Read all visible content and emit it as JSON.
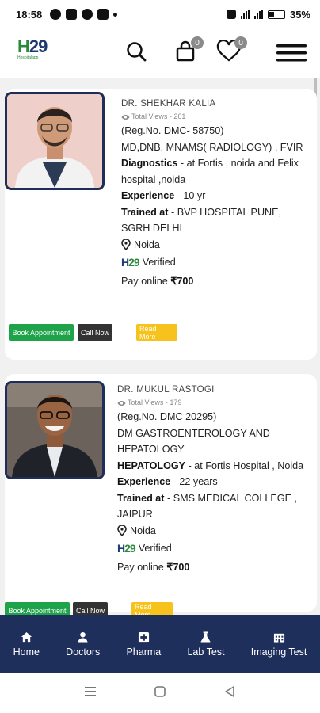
{
  "status_bar": {
    "time": "18:58",
    "battery": "35%"
  },
  "header": {
    "logo_text_main": "H",
    "logo_text_num": "29",
    "logo_sub": "Hospitalapp",
    "cart_count": "0",
    "wishlist_count": "0"
  },
  "doctors": [
    {
      "name": "DR. SHEKHAR KALIA",
      "views": "Total Views - 261",
      "reg": "(Reg.No. DMC- 58750)",
      "qualification": "MD,DNB, MNAMS( RADIOLOGY) , FVIR",
      "dept_label": "Diagnostics",
      "dept_value": " - at Fortis , noida and Felix hospital ,noida",
      "exp_label": "Experience",
      "exp_value": " - 10 yr",
      "trained_label": "Trained at",
      "trained_value": " - BVP HOSPITAL PUNE, SGRH DELHI",
      "location": "Noida",
      "verified": "Verified",
      "pay_label": "Pay online",
      "price": "₹700",
      "book_label": "Book Appointment",
      "call_label": "Call Now",
      "read_label": "Read More"
    },
    {
      "name": "DR. MUKUL RASTOGI",
      "views": "Total Views - 179",
      "reg": "(Reg.No. DMC 20295)",
      "qualification": "DM GASTROENTEROLOGY AND HEPATOLOGY",
      "dept_label": "HEPATOLOGY",
      "dept_value": " - at Fortis Hospital , Noida",
      "exp_label": "Experience",
      "exp_value": " - 22 years",
      "trained_label": "Trained at",
      "trained_value": " - SMS MEDICAL COLLEGE , JAIPUR",
      "location": "Noida",
      "verified": "Verified",
      "pay_label": "Pay online",
      "price": "₹700",
      "book_label": "Book Appointment",
      "call_label": "Call Now",
      "read_label": "Read More"
    }
  ],
  "bottom_nav": [
    {
      "label": "Home",
      "icon": "home-icon"
    },
    {
      "label": "Doctors",
      "icon": "user-icon"
    },
    {
      "label": "Pharma",
      "icon": "medical-plus-icon"
    },
    {
      "label": "Lab Test",
      "icon": "flask-icon"
    },
    {
      "label": "Imaging Test",
      "icon": "hospital-icon"
    }
  ],
  "colors": {
    "nav_bg": "#1f2f5c",
    "green": "#1ea34a",
    "yellow": "#f7c21b",
    "dark": "#333333"
  }
}
